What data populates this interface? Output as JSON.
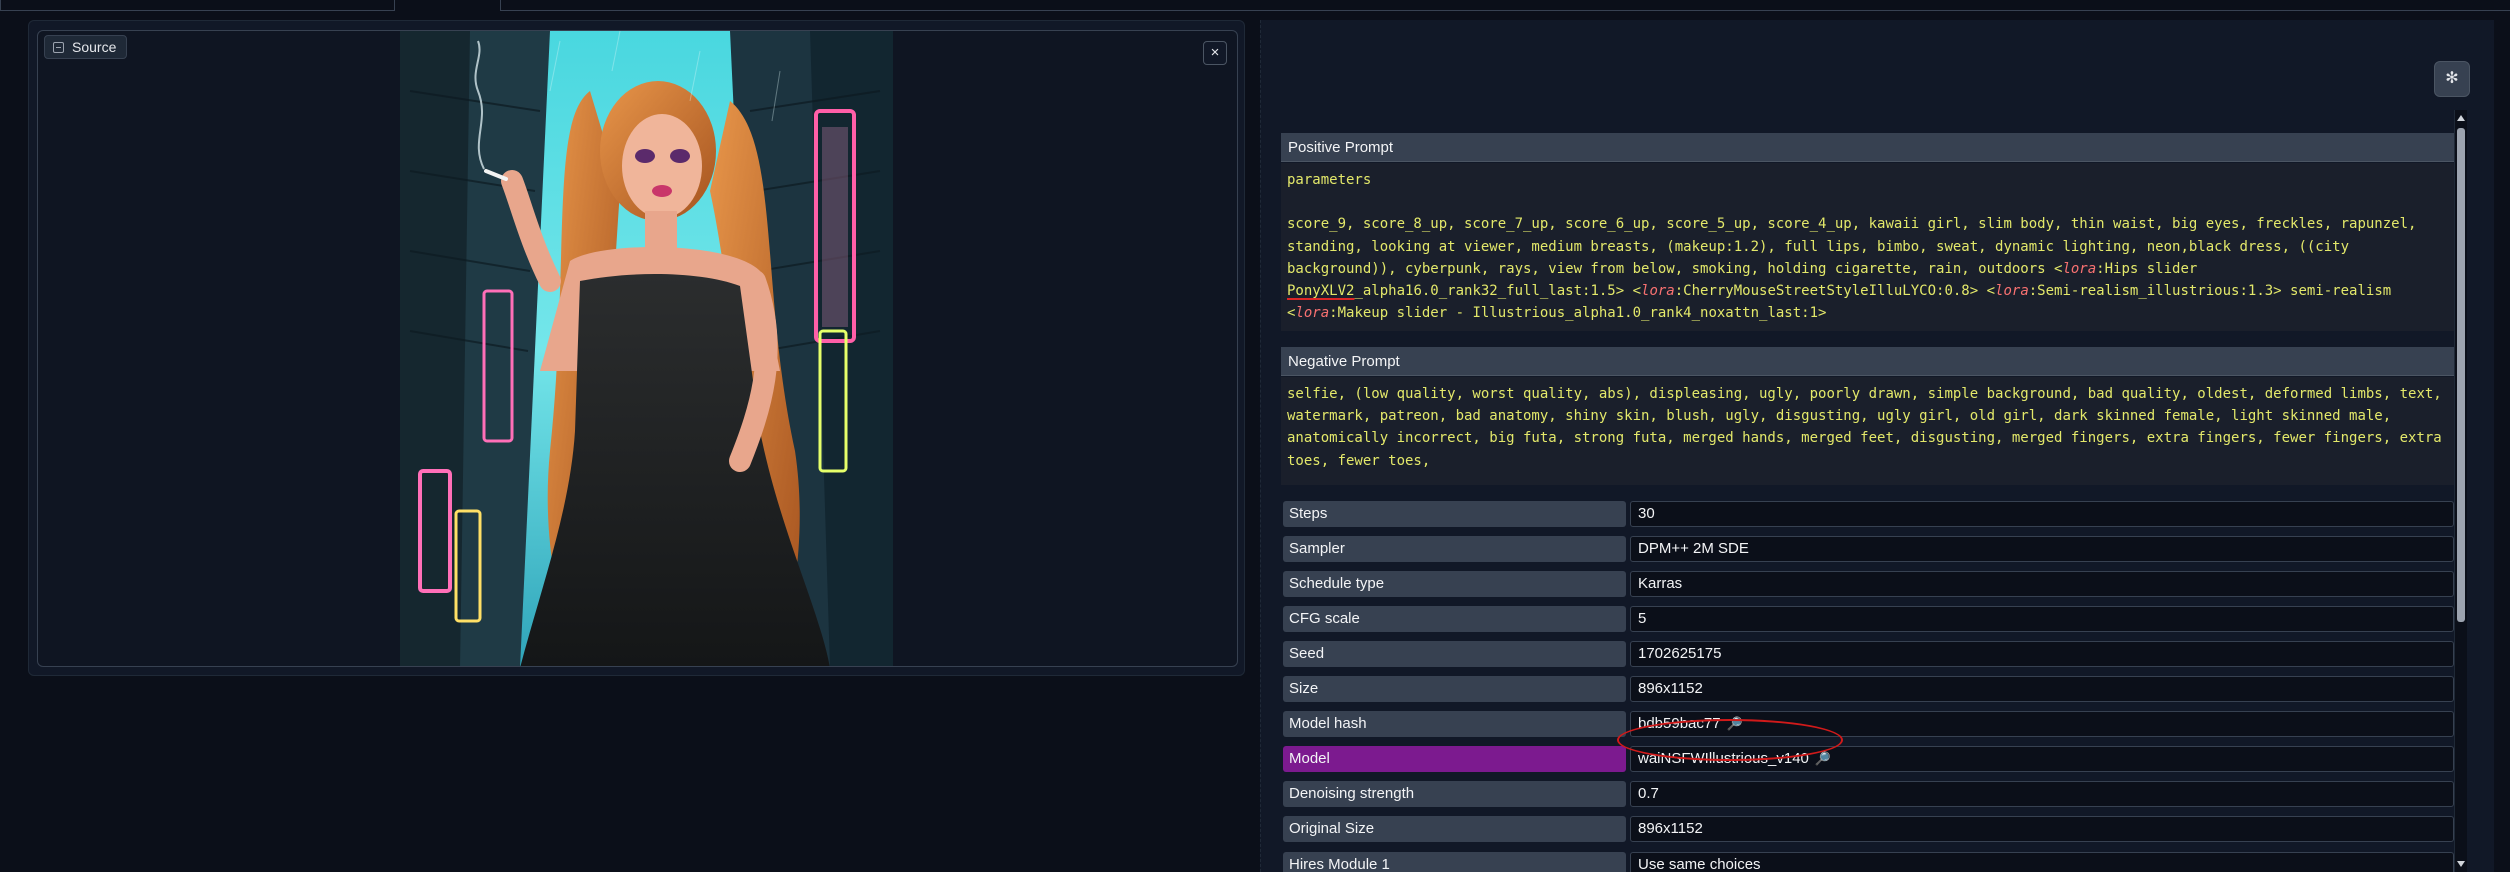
{
  "source_panel": {
    "label": "Source",
    "close_symbol": "×",
    "icon": "image-icon"
  },
  "settings_icon": "gear-icon",
  "positive_prompt": {
    "header": "Positive Prompt",
    "first_line": "parameters",
    "text_part1": "score_9, score_8_up, score_7_up, score_6_up, score_5_up, score_4_up, kawaii girl, slim body, thin waist, big eyes, freckles, rapunzel, standing, looking at viewer, medium breasts, (makeup:1.2), full lips, bimbo, sweat, dynamic lighting, neon,black dress, ((city background)), cyberpunk, rays, view from below, smoking, holding cigarette, rain, outdoors <",
    "lora_1": "lora",
    "lora_1_name_a": ":Hips slider ",
    "lora_1_name_b": "PonyXLV2",
    "lora_1_name_c": "_alpha16.0_rank32_full_last:1.5> <",
    "lora_2": "lora",
    "lora_2_name": ":CherryMouseStreetStyleIlluLYCO:0.8> <",
    "lora_3": "lora",
    "lora_3_name": ":Semi-realism_illustrious:1.3> semi-realism <",
    "lora_4": "lora",
    "lora_4_name": ":Makeup slider - Illustrious_alpha1.0_rank4_noxattn_last:1>"
  },
  "negative_prompt": {
    "header": "Negative Prompt",
    "text": "selfie, (low quality, worst quality, abs), displeasing, ugly, poorly drawn, simple background, bad quality, oldest, deformed limbs, text, watermark, patreon, bad anatomy, shiny skin, blush, ugly, disgusting, ugly girl, old girl, dark skinned female, light skinned male, anatomically incorrect, big futa, strong futa, merged hands, merged feet, disgusting, merged fingers, extra fingers, fewer fingers, extra toes, fewer toes,"
  },
  "params": [
    {
      "key": "Steps",
      "value": "30"
    },
    {
      "key": "Sampler",
      "value": "DPM++ 2M SDE"
    },
    {
      "key": "Schedule type",
      "value": "Karras"
    },
    {
      "key": "CFG scale",
      "value": "5"
    },
    {
      "key": "Seed",
      "value": "1702625175"
    },
    {
      "key": "Size",
      "value": "896x1152"
    },
    {
      "key": "Model hash",
      "value": "bdb59bac77"
    },
    {
      "key": "Model",
      "value": "waiNSFWIllustrious_v140"
    },
    {
      "key": "Denoising strength",
      "value": "0.7"
    },
    {
      "key": "Original Size",
      "value": "896x1152"
    },
    {
      "key": "Hires Module 1",
      "value": "Use same choices"
    }
  ],
  "colors": {
    "background": "#0b0f19",
    "panel": "#111827",
    "prompt_text": "#e3e86a",
    "lora_tag": "#f87171",
    "highlight_row": "#7c1a8f",
    "annotation": "#d11a1a"
  }
}
